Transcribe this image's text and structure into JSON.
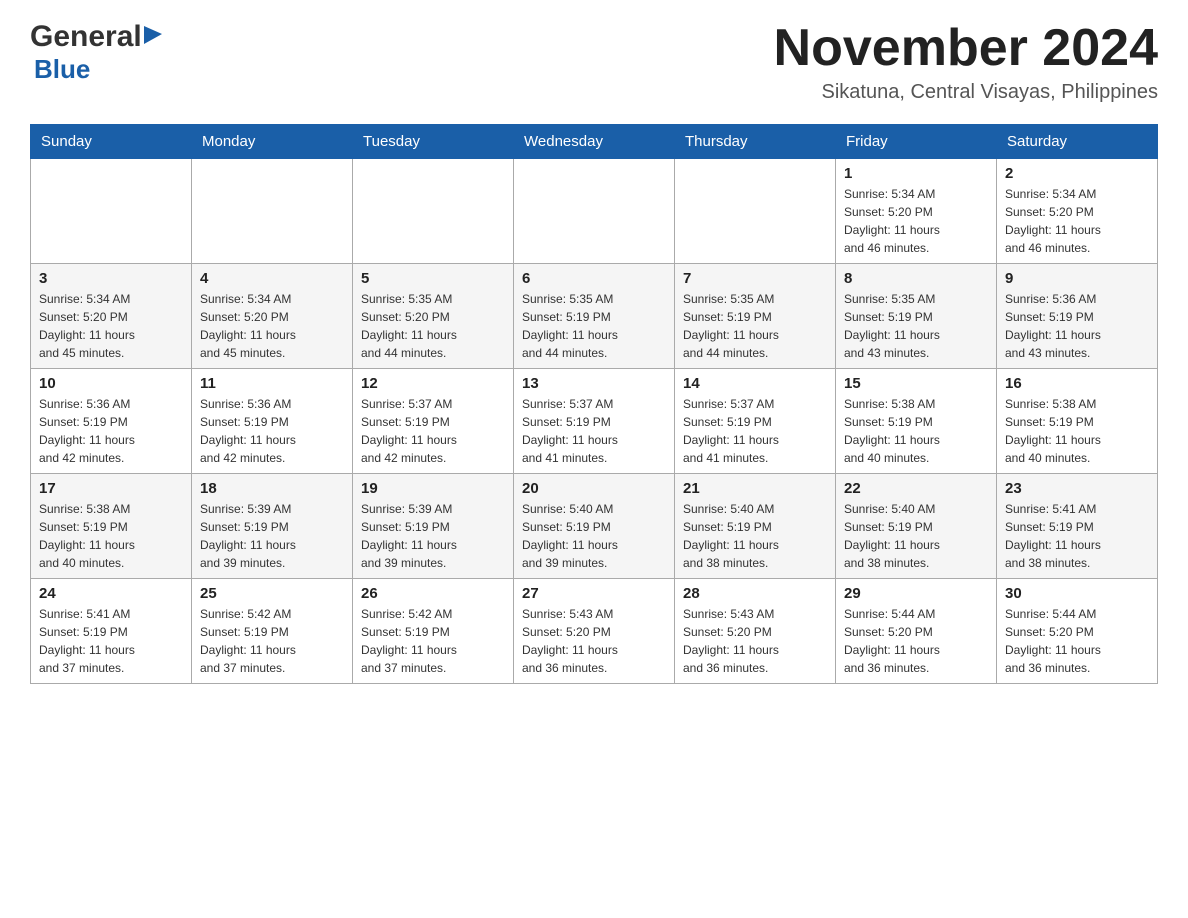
{
  "header": {
    "logo_general": "General",
    "logo_blue": "Blue",
    "month_title": "November 2024",
    "location": "Sikatuna, Central Visayas, Philippines"
  },
  "days_of_week": [
    "Sunday",
    "Monday",
    "Tuesday",
    "Wednesday",
    "Thursday",
    "Friday",
    "Saturday"
  ],
  "weeks": [
    {
      "days": [
        {
          "num": "",
          "info": ""
        },
        {
          "num": "",
          "info": ""
        },
        {
          "num": "",
          "info": ""
        },
        {
          "num": "",
          "info": ""
        },
        {
          "num": "",
          "info": ""
        },
        {
          "num": "1",
          "info": "Sunrise: 5:34 AM\nSunset: 5:20 PM\nDaylight: 11 hours\nand 46 minutes."
        },
        {
          "num": "2",
          "info": "Sunrise: 5:34 AM\nSunset: 5:20 PM\nDaylight: 11 hours\nand 46 minutes."
        }
      ]
    },
    {
      "days": [
        {
          "num": "3",
          "info": "Sunrise: 5:34 AM\nSunset: 5:20 PM\nDaylight: 11 hours\nand 45 minutes."
        },
        {
          "num": "4",
          "info": "Sunrise: 5:34 AM\nSunset: 5:20 PM\nDaylight: 11 hours\nand 45 minutes."
        },
        {
          "num": "5",
          "info": "Sunrise: 5:35 AM\nSunset: 5:20 PM\nDaylight: 11 hours\nand 44 minutes."
        },
        {
          "num": "6",
          "info": "Sunrise: 5:35 AM\nSunset: 5:19 PM\nDaylight: 11 hours\nand 44 minutes."
        },
        {
          "num": "7",
          "info": "Sunrise: 5:35 AM\nSunset: 5:19 PM\nDaylight: 11 hours\nand 44 minutes."
        },
        {
          "num": "8",
          "info": "Sunrise: 5:35 AM\nSunset: 5:19 PM\nDaylight: 11 hours\nand 43 minutes."
        },
        {
          "num": "9",
          "info": "Sunrise: 5:36 AM\nSunset: 5:19 PM\nDaylight: 11 hours\nand 43 minutes."
        }
      ]
    },
    {
      "days": [
        {
          "num": "10",
          "info": "Sunrise: 5:36 AM\nSunset: 5:19 PM\nDaylight: 11 hours\nand 42 minutes."
        },
        {
          "num": "11",
          "info": "Sunrise: 5:36 AM\nSunset: 5:19 PM\nDaylight: 11 hours\nand 42 minutes."
        },
        {
          "num": "12",
          "info": "Sunrise: 5:37 AM\nSunset: 5:19 PM\nDaylight: 11 hours\nand 42 minutes."
        },
        {
          "num": "13",
          "info": "Sunrise: 5:37 AM\nSunset: 5:19 PM\nDaylight: 11 hours\nand 41 minutes."
        },
        {
          "num": "14",
          "info": "Sunrise: 5:37 AM\nSunset: 5:19 PM\nDaylight: 11 hours\nand 41 minutes."
        },
        {
          "num": "15",
          "info": "Sunrise: 5:38 AM\nSunset: 5:19 PM\nDaylight: 11 hours\nand 40 minutes."
        },
        {
          "num": "16",
          "info": "Sunrise: 5:38 AM\nSunset: 5:19 PM\nDaylight: 11 hours\nand 40 minutes."
        }
      ]
    },
    {
      "days": [
        {
          "num": "17",
          "info": "Sunrise: 5:38 AM\nSunset: 5:19 PM\nDaylight: 11 hours\nand 40 minutes."
        },
        {
          "num": "18",
          "info": "Sunrise: 5:39 AM\nSunset: 5:19 PM\nDaylight: 11 hours\nand 39 minutes."
        },
        {
          "num": "19",
          "info": "Sunrise: 5:39 AM\nSunset: 5:19 PM\nDaylight: 11 hours\nand 39 minutes."
        },
        {
          "num": "20",
          "info": "Sunrise: 5:40 AM\nSunset: 5:19 PM\nDaylight: 11 hours\nand 39 minutes."
        },
        {
          "num": "21",
          "info": "Sunrise: 5:40 AM\nSunset: 5:19 PM\nDaylight: 11 hours\nand 38 minutes."
        },
        {
          "num": "22",
          "info": "Sunrise: 5:40 AM\nSunset: 5:19 PM\nDaylight: 11 hours\nand 38 minutes."
        },
        {
          "num": "23",
          "info": "Sunrise: 5:41 AM\nSunset: 5:19 PM\nDaylight: 11 hours\nand 38 minutes."
        }
      ]
    },
    {
      "days": [
        {
          "num": "24",
          "info": "Sunrise: 5:41 AM\nSunset: 5:19 PM\nDaylight: 11 hours\nand 37 minutes."
        },
        {
          "num": "25",
          "info": "Sunrise: 5:42 AM\nSunset: 5:19 PM\nDaylight: 11 hours\nand 37 minutes."
        },
        {
          "num": "26",
          "info": "Sunrise: 5:42 AM\nSunset: 5:19 PM\nDaylight: 11 hours\nand 37 minutes."
        },
        {
          "num": "27",
          "info": "Sunrise: 5:43 AM\nSunset: 5:20 PM\nDaylight: 11 hours\nand 36 minutes."
        },
        {
          "num": "28",
          "info": "Sunrise: 5:43 AM\nSunset: 5:20 PM\nDaylight: 11 hours\nand 36 minutes."
        },
        {
          "num": "29",
          "info": "Sunrise: 5:44 AM\nSunset: 5:20 PM\nDaylight: 11 hours\nand 36 minutes."
        },
        {
          "num": "30",
          "info": "Sunrise: 5:44 AM\nSunset: 5:20 PM\nDaylight: 11 hours\nand 36 minutes."
        }
      ]
    }
  ]
}
